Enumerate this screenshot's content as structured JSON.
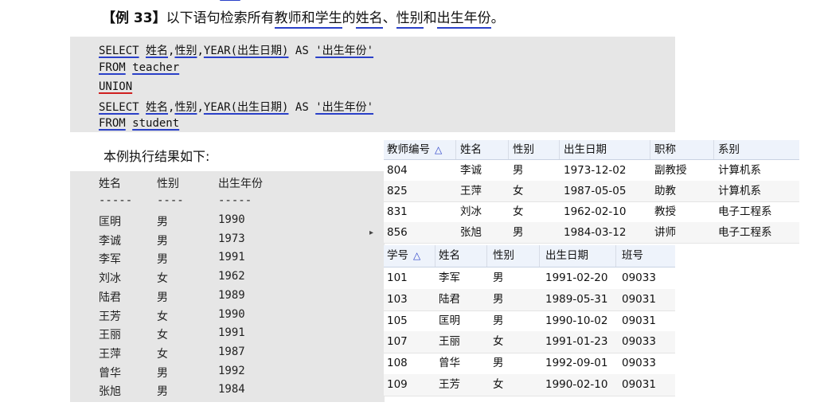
{
  "heading": {
    "tag": "【例 33】",
    "text_plain": "以下语句检索所有",
    "text_u1": "教师和学生",
    "text_mid1": "的",
    "text_u2": "姓名",
    "text_mid2": "、",
    "text_u3": "性别",
    "text_mid3": "和",
    "text_u4": "出生年份",
    "text_end": "。"
  },
  "sql": {
    "line1": {
      "kw": "SELECT",
      "f1": "姓名",
      "c1": ",",
      "f2": "性别",
      "c2": ",",
      "fn": "YEAR(出生日期)",
      "as": " AS ",
      "alias": "'出生年份'"
    },
    "line2": {
      "kw": "FROM",
      "sp": " ",
      "tbl": "teacher"
    },
    "line3": {
      "kw": "UNION"
    },
    "line4": {
      "kw": "SELECT",
      "f1": "姓名",
      "c1": ",",
      "f2": "性别",
      "c2": ",",
      "fn": "YEAR(出生日期)",
      "as": " AS ",
      "alias": "'出生年份'"
    },
    "line5": {
      "kw": "FROM",
      "sp": " ",
      "tbl": "student"
    }
  },
  "result_caption": "本例执行结果如下:",
  "result": {
    "headers": [
      "姓名",
      "性别",
      "出生年份"
    ],
    "dashes": [
      "-----",
      "----",
      "-----"
    ],
    "rows": [
      [
        "匡明",
        "男",
        "1990"
      ],
      [
        "李诚",
        "男",
        "1973"
      ],
      [
        "李军",
        "男",
        "1991"
      ],
      [
        "刘冰",
        "女",
        "1962"
      ],
      [
        "陆君",
        "男",
        "1989"
      ],
      [
        "王芳",
        "女",
        "1990"
      ],
      [
        "王丽",
        "女",
        "1991"
      ],
      [
        "王萍",
        "女",
        "1987"
      ],
      [
        "曾华",
        "男",
        "1992"
      ],
      [
        "张旭",
        "男",
        "1984"
      ]
    ]
  },
  "teacher_table": {
    "columns": [
      "教师编号",
      "姓名",
      "性别",
      "出生日期",
      "职称",
      "系别"
    ],
    "sort_indicator": "△",
    "rows": [
      [
        "804",
        "李诚",
        "男",
        "1973-12-02",
        "副教授",
        "计算机系"
      ],
      [
        "825",
        "王萍",
        "女",
        "1987-05-05",
        "助教",
        "计算机系"
      ],
      [
        "831",
        "刘冰",
        "女",
        "1962-02-10",
        "教授",
        "电子工程系"
      ],
      [
        "856",
        "张旭",
        "男",
        "1984-03-12",
        "讲师",
        "电子工程系"
      ]
    ]
  },
  "student_table": {
    "columns": [
      "学号",
      "姓名",
      "性别",
      "出生日期",
      "班号"
    ],
    "sort_indicator": "△",
    "rows": [
      [
        "101",
        "李军",
        "男",
        "1991-02-20",
        "09033"
      ],
      [
        "103",
        "陆君",
        "男",
        "1989-05-31",
        "09031"
      ],
      [
        "105",
        "匡明",
        "男",
        "1990-10-02",
        "09031"
      ],
      [
        "107",
        "王丽",
        "女",
        "1991-01-23",
        "09033"
      ],
      [
        "108",
        "曾华",
        "男",
        "1992-09-01",
        "09033"
      ],
      [
        "109",
        "王芳",
        "女",
        "1990-02-10",
        "09031"
      ]
    ]
  }
}
